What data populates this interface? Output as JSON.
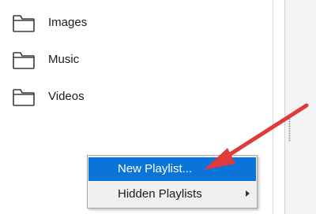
{
  "nav": {
    "items": [
      {
        "label": "Images",
        "icon": "folder-icon"
      },
      {
        "label": "Music",
        "icon": "folder-icon"
      },
      {
        "label": "Videos",
        "icon": "folder-icon"
      }
    ]
  },
  "context_menu": {
    "items": [
      {
        "label": "New Playlist...",
        "highlighted": true,
        "has_submenu": false
      },
      {
        "label": "Hidden Playlists",
        "highlighted": false,
        "has_submenu": true
      }
    ]
  },
  "annotation": {
    "icon": "red-arrow-icon",
    "color": "#e03b3b"
  },
  "colors": {
    "menu_highlight": "#0a74d8",
    "menu_background": "#f0f0f0"
  }
}
